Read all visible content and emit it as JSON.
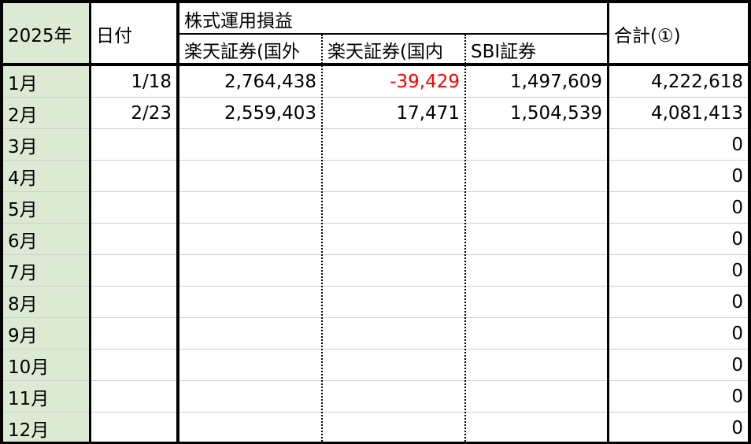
{
  "header": {
    "year": "2025年",
    "date": "日付",
    "group": "株式運用損益",
    "col1": "楽天証券(国外",
    "col2": "楽天証券(国内",
    "col3": "SBI証券",
    "total": "合計(①)"
  },
  "rows": [
    {
      "month": "1月",
      "date": "1/18",
      "v1": "2,764,438",
      "v2": "-39,429",
      "v3": "1,497,609",
      "total": "4,222,618"
    },
    {
      "month": "2月",
      "date": "2/23",
      "v1": "2,559,403",
      "v2": "17,471",
      "v3": "1,504,539",
      "total": "4,081,413"
    },
    {
      "month": "3月",
      "date": "",
      "v1": "",
      "v2": "",
      "v3": "",
      "total": "0"
    },
    {
      "month": "4月",
      "date": "",
      "v1": "",
      "v2": "",
      "v3": "",
      "total": "0"
    },
    {
      "month": "5月",
      "date": "",
      "v1": "",
      "v2": "",
      "v3": "",
      "total": "0"
    },
    {
      "month": "6月",
      "date": "",
      "v1": "",
      "v2": "",
      "v3": "",
      "total": "0"
    },
    {
      "month": "7月",
      "date": "",
      "v1": "",
      "v2": "",
      "v3": "",
      "total": "0"
    },
    {
      "month": "8月",
      "date": "",
      "v1": "",
      "v2": "",
      "v3": "",
      "total": "0"
    },
    {
      "month": "9月",
      "date": "",
      "v1": "",
      "v2": "",
      "v3": "",
      "total": "0"
    },
    {
      "month": "10月",
      "date": "",
      "v1": "",
      "v2": "",
      "v3": "",
      "total": "0"
    },
    {
      "month": "11月",
      "date": "",
      "v1": "",
      "v2": "",
      "v3": "",
      "total": "0"
    },
    {
      "month": "12月",
      "date": "",
      "v1": "",
      "v2": "",
      "v3": "",
      "total": "0"
    }
  ],
  "colors": {
    "month_fill": "#dcead3",
    "negative": "#ff0000"
  }
}
